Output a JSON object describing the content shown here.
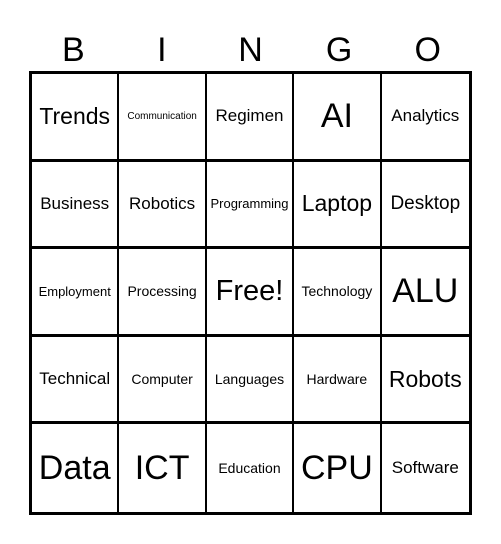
{
  "header": {
    "letters": [
      "B",
      "I",
      "N",
      "G",
      "O"
    ]
  },
  "card": {
    "rows": [
      [
        "Trends",
        "Communication",
        "Regimen",
        "AI",
        "Analytics"
      ],
      [
        "Business",
        "Robotics",
        "Programming",
        "Laptop",
        "Desktop"
      ],
      [
        "Employment",
        "Processing",
        "Free!",
        "Technology",
        "ALU"
      ],
      [
        "Technical",
        "Computer",
        "Languages",
        "Hardware",
        "Robots"
      ],
      [
        "Data",
        "ICT",
        "Education",
        "CPU",
        "Software"
      ]
    ]
  }
}
